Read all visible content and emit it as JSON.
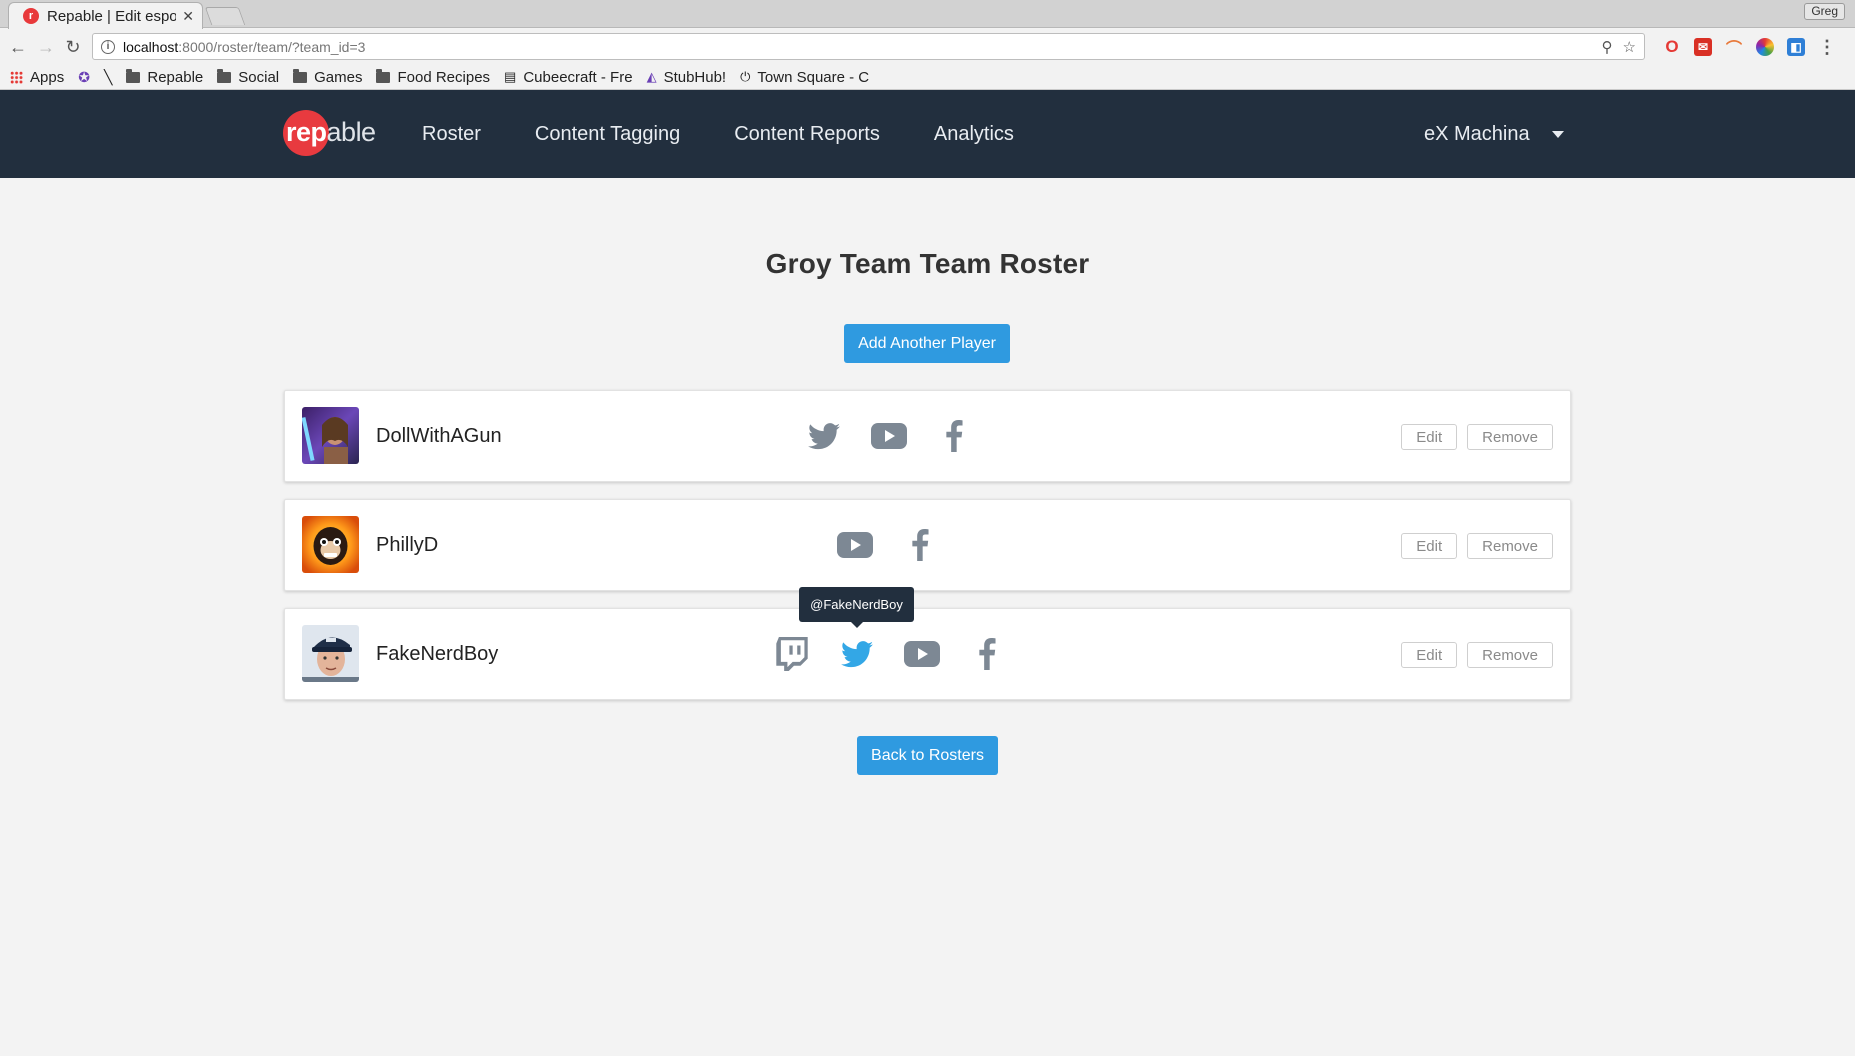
{
  "browser": {
    "tab_title": "Repable | Edit espo",
    "tab_favicon_letter": "r",
    "profile_name": "Greg",
    "url_host": "localhost",
    "url_path": ":8000/roster/team/?team_id=3",
    "bookmarks": [
      {
        "label": "Apps",
        "icon": "apps-grid-icon"
      },
      {
        "label": "",
        "icon": "extension-icon"
      },
      {
        "label": "",
        "icon": "wand-icon"
      },
      {
        "label": "Repable",
        "icon": "folder-icon"
      },
      {
        "label": "Social",
        "icon": "folder-icon"
      },
      {
        "label": "Games",
        "icon": "folder-icon"
      },
      {
        "label": "Food Recipes",
        "icon": "folder-icon"
      },
      {
        "label": "Cubeecraft - Fre",
        "icon": "page-icon"
      },
      {
        "label": "StubHub!",
        "icon": "stubhub-icon"
      },
      {
        "label": "Town Square - C",
        "icon": "power-icon"
      }
    ]
  },
  "nav": {
    "logo_rep": "rep",
    "logo_able": "able",
    "links": [
      "Roster",
      "Content Tagging",
      "Content Reports",
      "Analytics"
    ],
    "account": "eX Machina"
  },
  "page": {
    "title": "Groy Team Team Roster",
    "add_button": "Add Another Player",
    "back_button": "Back to Rosters"
  },
  "players": [
    {
      "name": "DollWithAGun",
      "socials": [
        "twitter",
        "youtube",
        "facebook"
      ],
      "edit": "Edit",
      "remove": "Remove"
    },
    {
      "name": "PhillyD",
      "socials": [
        "youtube",
        "facebook"
      ],
      "edit": "Edit",
      "remove": "Remove"
    },
    {
      "name": "FakeNerdBoy",
      "socials": [
        "twitch",
        "twitter",
        "youtube",
        "facebook"
      ],
      "edit": "Edit",
      "remove": "Remove"
    }
  ],
  "tooltip": "@FakeNerdBoy",
  "colors": {
    "navbar": "#222f3e",
    "brand_red": "#e83a3f",
    "primary_button": "#2f9ae0",
    "social_icon": "#7d8894",
    "twitter_active": "#33a7e6"
  }
}
